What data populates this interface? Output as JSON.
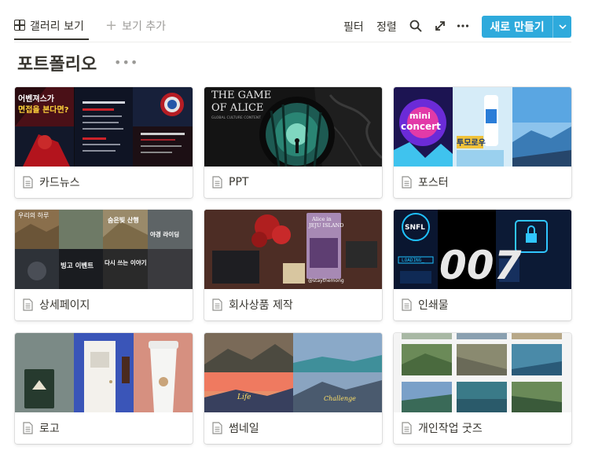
{
  "toolbar": {
    "view_tab_label": "갤러리 보기",
    "add_view_label": "보기 추가",
    "filter_label": "필터",
    "sort_label": "정렬",
    "new_button_label": "새로 만들기"
  },
  "page": {
    "title": "포트폴리오"
  },
  "cards": [
    {
      "label": "카드뉴스",
      "cover": {
        "overlay_line1": "어벤져스가",
        "overlay_line2": "면접을 본다면?"
      }
    },
    {
      "label": "PPT",
      "cover": {
        "title_line1": "THE GAME",
        "title_line2": "OF ALICE",
        "subtitle": "GLOBAL CULTURE CONTENT"
      }
    },
    {
      "label": "포스터",
      "cover": {
        "text_a": "mini",
        "text_b": "concert",
        "text_c": "투모로우"
      }
    },
    {
      "label": "상세페이지",
      "cover": {
        "text_a": "숨은빛 산행",
        "text_b": "야경 라이딩",
        "text_c": "빙고 이벤트",
        "text_d": "다시 쓰는 이야기"
      }
    },
    {
      "label": "회사상품 제작",
      "cover": {
        "text_a": "Alice in",
        "text_b": "JEJU ISLAND",
        "text_c": "@staythemong"
      }
    },
    {
      "label": "인쇄물",
      "cover": {
        "text_a": "SNFL",
        "text_b": "LOADING_",
        "text_c": "007"
      }
    },
    {
      "label": "로고",
      "cover": {}
    },
    {
      "label": "썸네일",
      "cover": {
        "text_a": "Life",
        "text_b": "Challenge"
      }
    },
    {
      "label": "개인작업 굿즈",
      "cover": {}
    }
  ],
  "colors": {
    "accent": "#2eaadc",
    "text": "#37352f",
    "muted": "#9b9a97"
  },
  "icons": [
    "gallery-grid-icon",
    "plus-icon",
    "search-icon",
    "expand-icon",
    "more-icon",
    "chevron-down-icon",
    "page-icon"
  ]
}
